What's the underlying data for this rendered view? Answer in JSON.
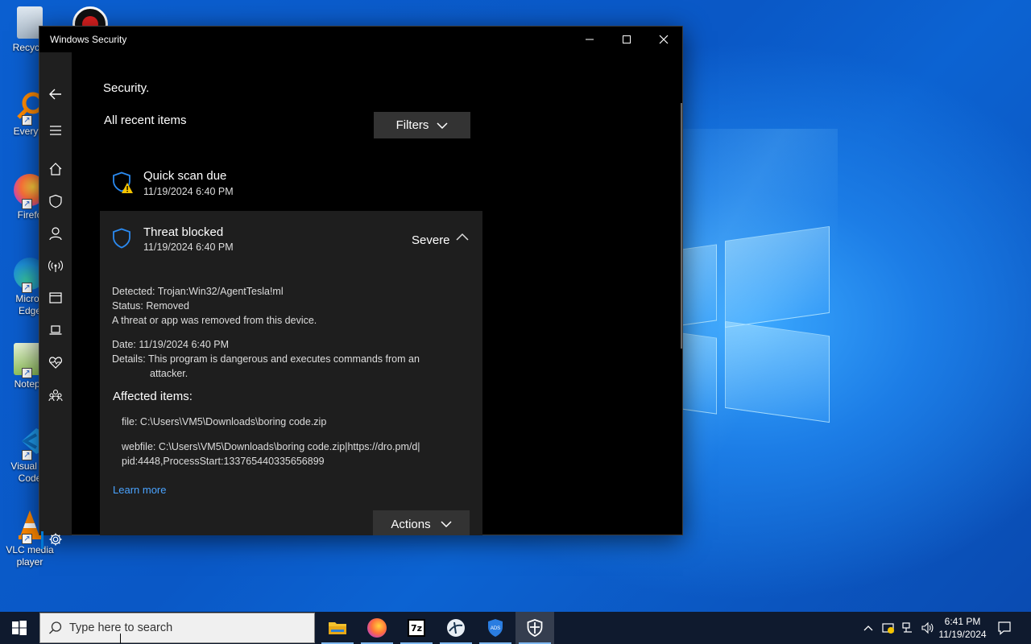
{
  "desktop": {
    "icons": [
      {
        "label": "Recycle",
        "icon": "recycle-bin-icon"
      },
      {
        "label": "Everyth",
        "icon": "everything-search-icon"
      },
      {
        "label": "Firefo",
        "icon": "firefox-icon"
      },
      {
        "label": "Micros Edge",
        "icon": "edge-icon"
      },
      {
        "label": "Notepa",
        "icon": "notepad-plus-plus-icon"
      },
      {
        "label": "Visual St Code",
        "icon": "vscode-icon"
      },
      {
        "label": "VLC media player",
        "icon": "vlc-icon"
      }
    ]
  },
  "window": {
    "title": "Windows Security",
    "top_text": "Security.",
    "section_title": "All recent items",
    "filters_label": "Filters",
    "items": [
      {
        "title": "Quick scan due",
        "date": "11/19/2024 6:40 PM",
        "icon": "shield-warning-icon"
      }
    ],
    "threat": {
      "title": "Threat blocked",
      "date": "11/19/2024 6:40 PM",
      "severity": "Severe",
      "detected_key": "Detected:",
      "detected_val": "Trojan:Win32/AgentTesla!ml",
      "status_key": "Status:",
      "status_val": "Removed",
      "removed_text": "A threat or app was removed from this device.",
      "date_key": "Date:",
      "date_val": "11/19/2024 6:40 PM",
      "details_key": "Details:",
      "details_line1": "This program is dangerous and executes commands from an",
      "details_line2": "attacker.",
      "affected_title": "Affected items:",
      "affected_file": "file: C:\\Users\\VM5\\Downloads\\boring code.zip",
      "affected_web_line1": "webfile: C:\\Users\\VM5\\Downloads\\boring code.zip|https://dro.pm/d|",
      "affected_web_line2": "pid:4448,ProcessStart:133765440335656899",
      "learn_more": "Learn more",
      "actions_label": "Actions"
    }
  },
  "taskbar": {
    "search_placeholder": "Type here to search",
    "apps": [
      "file-explorer-icon",
      "firefox-icon",
      "7zip-icon",
      "network-app-icon",
      "defender-shield-icon",
      "windows-security-icon"
    ],
    "clock_time": "6:41 PM",
    "clock_date": "11/19/2024"
  },
  "colors": {
    "accent": "#0078d4",
    "link": "#4aa3ff",
    "warning": "#f5c400"
  }
}
